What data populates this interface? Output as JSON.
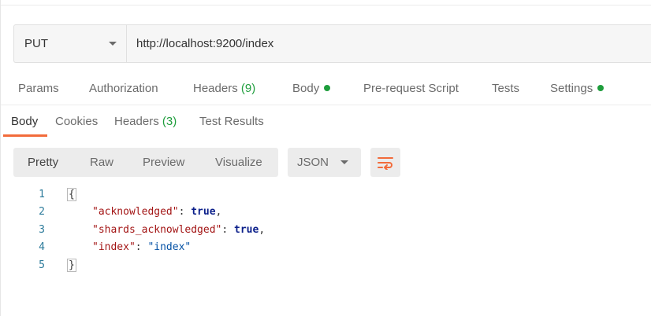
{
  "request": {
    "method": "PUT",
    "url": "http://localhost:9200/index"
  },
  "request_tabs": [
    {
      "label": "Params"
    },
    {
      "label": "Authorization"
    },
    {
      "label": "Headers",
      "count": "(9)"
    },
    {
      "label": "Body",
      "indicator": "green-dot"
    },
    {
      "label": "Pre-request Script"
    },
    {
      "label": "Tests"
    },
    {
      "label": "Settings",
      "indicator": "green-dot"
    }
  ],
  "response_tabs": [
    {
      "label": "Body",
      "active": true
    },
    {
      "label": "Cookies"
    },
    {
      "label": "Headers",
      "count": "(3)"
    },
    {
      "label": "Test Results"
    }
  ],
  "format_options": [
    {
      "label": "Pretty",
      "active": true
    },
    {
      "label": "Raw"
    },
    {
      "label": "Preview"
    },
    {
      "label": "Visualize"
    }
  ],
  "language": "JSON",
  "wrap_icon": "wrap-lines-icon",
  "code_lines": [
    {
      "num": "1",
      "open": "{"
    },
    {
      "num": "2",
      "key": "\"acknowledged\"",
      "sep": ": ",
      "value": "true",
      "value_type": "keyword",
      "tail": ","
    },
    {
      "num": "3",
      "key": "\"shards_acknowledged\"",
      "sep": ": ",
      "value": "true",
      "value_type": "keyword",
      "tail": ","
    },
    {
      "num": "4",
      "key": "\"index\"",
      "sep": ": ",
      "value": "\"index\"",
      "value_type": "string",
      "tail": ""
    },
    {
      "num": "5",
      "close": "}"
    }
  ],
  "colors": {
    "accent": "#f26b3a",
    "indicator_green": "#1e9d3c",
    "json_key": "#a31515",
    "json_keyword": "#0b1f8a",
    "json_string": "#0451a5"
  }
}
